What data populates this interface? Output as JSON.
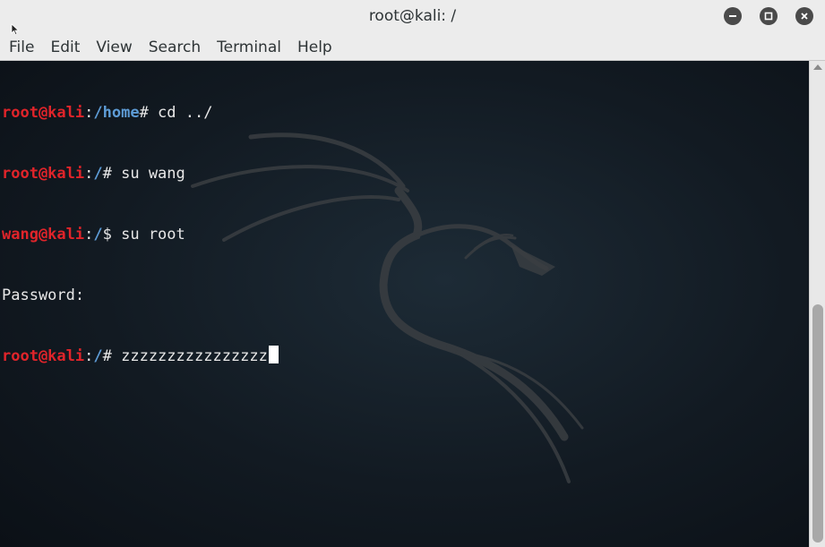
{
  "window": {
    "title": "root@kali: /",
    "buttons": {
      "minimize": "minimize-icon",
      "maximize": "maximize-icon",
      "close": "close-icon"
    }
  },
  "menu": {
    "items": [
      "File",
      "Edit",
      "View",
      "Search",
      "Terminal",
      "Help"
    ]
  },
  "terminal": {
    "lines": [
      {
        "user": "root@kali",
        "path": "/home",
        "symbol": "# ",
        "command": "cd ../"
      },
      {
        "user": "root@kali",
        "path": "/",
        "symbol": "# ",
        "command": "su wang"
      },
      {
        "user": "wang@kali",
        "path": "/",
        "symbol": "$ ",
        "command": "su root"
      },
      {
        "text": "Password:"
      },
      {
        "user": "root@kali",
        "path": "/",
        "symbol": "# ",
        "command": "zzzzzzzzzzzzzzzz"
      }
    ],
    "colors": {
      "user": "#e0242a",
      "path": "#5e9cd6",
      "text": "#e8e8e8",
      "background": "#121a22"
    }
  }
}
